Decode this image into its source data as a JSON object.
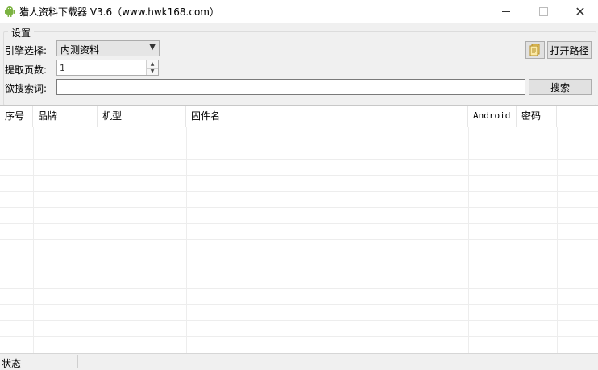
{
  "window": {
    "title": "猎人资料下载器 V3.6（www.hwk168.com）",
    "icon": "android-icon",
    "accent": "#7cb342"
  },
  "settings": {
    "group_label": "设置",
    "engine_label": "引擎选择:",
    "engine_value": "内测资料",
    "pages_label": "提取页数:",
    "pages_value": "1",
    "search_label": "欲搜索词:",
    "search_value": "",
    "search_button": "搜索",
    "open_path_button": "打开路径",
    "file_icon": "document-icon"
  },
  "table": {
    "columns": [
      "序号",
      "品牌",
      "机型",
      "固件名",
      "Android",
      "密码"
    ],
    "rows": []
  },
  "statusbar": {
    "label": "状态"
  }
}
